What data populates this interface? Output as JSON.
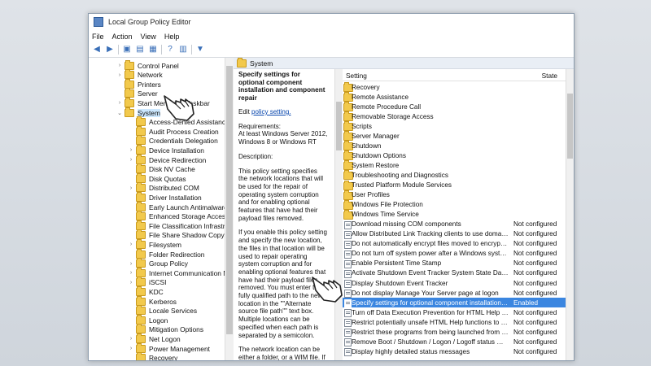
{
  "window": {
    "title": "Local Group Policy Editor"
  },
  "menu": [
    "File",
    "Action",
    "View",
    "Help"
  ],
  "toolbar": [
    {
      "icon": "back-arrow-icon",
      "glyph": "◀"
    },
    {
      "icon": "forward-arrow-icon",
      "glyph": "▶"
    },
    {
      "icon": "folder-up-icon",
      "glyph": "▣"
    },
    {
      "icon": "show-hide-tree-icon",
      "glyph": "▤"
    },
    {
      "icon": "export-list-icon",
      "glyph": "▦"
    },
    {
      "icon": "help-icon",
      "glyph": "?"
    },
    {
      "icon": "properties-icon",
      "glyph": "▥"
    },
    {
      "icon": "filter-icon",
      "glyph": "▼"
    }
  ],
  "tree": [
    {
      "label": "Control Panel",
      "expander": "›"
    },
    {
      "label": "Network",
      "expander": "›"
    },
    {
      "label": "Printers",
      "expander": ""
    },
    {
      "label": "Server",
      "expander": ""
    },
    {
      "label": "Start Menu and Taskbar",
      "expander": "›"
    },
    {
      "label": "System",
      "expander": "⌄",
      "selected": true
    },
    {
      "label": "Access-Denied Assistance",
      "expander": ""
    },
    {
      "label": "Audit Process Creation",
      "expander": ""
    },
    {
      "label": "Credentials Delegation",
      "expander": ""
    },
    {
      "label": "Device Installation",
      "expander": "›"
    },
    {
      "label": "Device Redirection",
      "expander": "›"
    },
    {
      "label": "Disk NV Cache",
      "expander": ""
    },
    {
      "label": "Disk Quotas",
      "expander": ""
    },
    {
      "label": "Distributed COM",
      "expander": "›"
    },
    {
      "label": "Driver Installation",
      "expander": ""
    },
    {
      "label": "Early Launch Antimalware",
      "expander": ""
    },
    {
      "label": "Enhanced Storage Access",
      "expander": ""
    },
    {
      "label": "File Classification Infrastru",
      "expander": ""
    },
    {
      "label": "File Share Shadow Copy Pr",
      "expander": ""
    },
    {
      "label": "Filesystem",
      "expander": "›"
    },
    {
      "label": "Folder Redirection",
      "expander": ""
    },
    {
      "label": "Group Policy",
      "expander": "›"
    },
    {
      "label": "Internet Communication M",
      "expander": "›"
    },
    {
      "label": "iSCSI",
      "expander": "›"
    },
    {
      "label": "KDC",
      "expander": ""
    },
    {
      "label": "Kerberos",
      "expander": ""
    },
    {
      "label": "Locale Services",
      "expander": ""
    },
    {
      "label": "Logon",
      "expander": ""
    },
    {
      "label": "Mitigation Options",
      "expander": ""
    },
    {
      "label": "Net Logon",
      "expander": "›"
    },
    {
      "label": "Power Management",
      "expander": "›"
    },
    {
      "label": "Recovery",
      "expander": ""
    }
  ],
  "pane": {
    "header": "System",
    "desc_title": "Specify settings for optional component installation and component repair",
    "edit_prefix": "Edit ",
    "edit_link": "policy setting.",
    "requirements": "Requirements:\nAt least Windows Server 2012, Windows 8 or Windows RT",
    "description_label": "Description:",
    "para1": "This policy setting specifies the network locations that will be used for the repair of operating system corruption and for enabling optional features that have had their payload files removed.",
    "para2": "If you enable this policy setting and specify the new location, the files in that location will be used to repair operating system corruption and for enabling optional features that have had their payload files removed. You must enter the fully qualified path to the new location in the \"\"Alternate source file path\"\" text box. Multiple locations can be specified when each path is separated by a semicolon.",
    "para3": "The network location can be either a folder, or a WIM file. If it is a WIM file..."
  },
  "list": {
    "col_setting": "Setting",
    "col_state": "State",
    "rows": [
      {
        "name": "Recovery",
        "state": "",
        "kind": "folder"
      },
      {
        "name": "Remote Assistance",
        "state": "",
        "kind": "folder"
      },
      {
        "name": "Remote Procedure Call",
        "state": "",
        "kind": "folder"
      },
      {
        "name": "Removable Storage Access",
        "state": "",
        "kind": "folder"
      },
      {
        "name": "Scripts",
        "state": "",
        "kind": "folder"
      },
      {
        "name": "Server Manager",
        "state": "",
        "kind": "folder"
      },
      {
        "name": "Shutdown",
        "state": "",
        "kind": "folder"
      },
      {
        "name": "Shutdown Options",
        "state": "",
        "kind": "folder"
      },
      {
        "name": "System Restore",
        "state": "",
        "kind": "folder"
      },
      {
        "name": "Troubleshooting and Diagnostics",
        "state": "",
        "kind": "folder"
      },
      {
        "name": "Trusted Platform Module Services",
        "state": "",
        "kind": "folder"
      },
      {
        "name": "User Profiles",
        "state": "",
        "kind": "folder"
      },
      {
        "name": "Windows File Protection",
        "state": "",
        "kind": "folder"
      },
      {
        "name": "Windows Time Service",
        "state": "",
        "kind": "folder"
      },
      {
        "name": "Download missing COM components",
        "state": "Not configured",
        "kind": "policy"
      },
      {
        "name": "Allow Distributed Link Tracking clients to use domain resour...",
        "state": "Not configured",
        "kind": "policy"
      },
      {
        "name": "Do not automatically encrypt files moved to encrypted fold...",
        "state": "Not configured",
        "kind": "policy"
      },
      {
        "name": "Do not turn off system power after a Windows system shutd...",
        "state": "Not configured",
        "kind": "policy"
      },
      {
        "name": "Enable Persistent Time Stamp",
        "state": "Not configured",
        "kind": "policy"
      },
      {
        "name": "Activate Shutdown Event Tracker System State Data feature",
        "state": "Not configured",
        "kind": "policy"
      },
      {
        "name": "Display Shutdown Event Tracker",
        "state": "Not configured",
        "kind": "policy"
      },
      {
        "name": "Do not display Manage Your Server page at logon",
        "state": "Not configured",
        "kind": "policy"
      },
      {
        "name": "Specify settings for optional component installation and co...",
        "state": "Enabled",
        "kind": "policy",
        "selected": true
      },
      {
        "name": "Turn off Data Execution Prevention for HTML Help Executible",
        "state": "Not configured",
        "kind": "policy"
      },
      {
        "name": "Restrict potentially unsafe HTML Help functions to specified...",
        "state": "Not configured",
        "kind": "policy"
      },
      {
        "name": "Restrict these programs from being launched from Help",
        "state": "Not configured",
        "kind": "policy"
      },
      {
        "name": "Remove Boot / Shutdown / Logon / Logoff status messages",
        "state": "Not configured",
        "kind": "policy"
      },
      {
        "name": "Display highly detailed status messages",
        "state": "Not configured",
        "kind": "policy"
      }
    ]
  },
  "colors": {
    "selection": "#3b86e0",
    "tree_selection": "#cce8ff",
    "folder": "#f2c94c",
    "link": "#0645ad"
  }
}
